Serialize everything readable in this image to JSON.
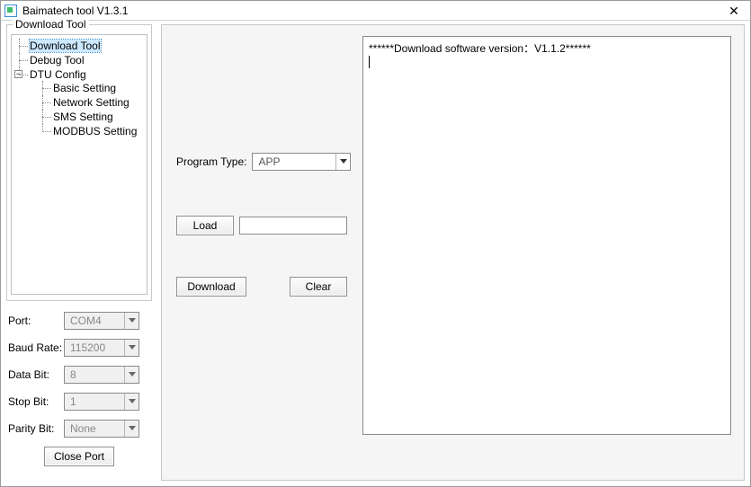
{
  "window": {
    "title": "Baimatech tool V1.3.1"
  },
  "group": {
    "legend": "Download Tool"
  },
  "tree": {
    "items": [
      {
        "label": "Download Tool",
        "selected": true
      },
      {
        "label": "Debug Tool"
      },
      {
        "label": "DTU Config",
        "expandable": true,
        "expanded": true,
        "children": [
          {
            "label": "Basic Setting"
          },
          {
            "label": "Network Setting"
          },
          {
            "label": "SMS Setting"
          },
          {
            "label": "MODBUS Setting"
          }
        ]
      }
    ]
  },
  "port_panel": {
    "port_label": "Port:",
    "port_value": "COM4",
    "baud_label": "Baud Rate:",
    "baud_value": "115200",
    "databit_label": "Data Bit:",
    "databit_value": "8",
    "stopbit_label": "Stop Bit:",
    "stopbit_value": "1",
    "parity_label": "Parity Bit:",
    "parity_value": "None",
    "close_port_label": "Close Port"
  },
  "main": {
    "program_type_label": "Program Type:",
    "program_type_value": "APP",
    "load_label": "Load",
    "load_path": "",
    "download_label": "Download",
    "clear_label": "Clear",
    "log_text": "******Download software version：V1.1.2******"
  }
}
